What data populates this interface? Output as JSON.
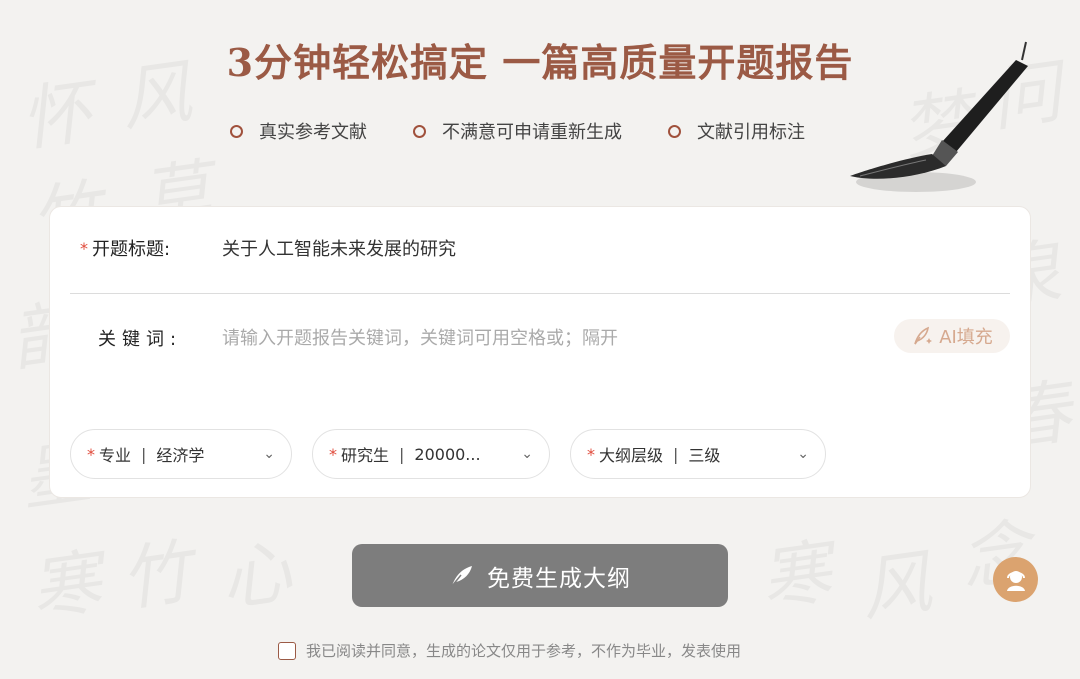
{
  "header": {
    "headline": "3分钟轻松搞定 一篇高质量开题报告",
    "features": [
      "真实参考文献",
      "不满意可申请重新生成",
      "文献引用标注"
    ]
  },
  "form": {
    "title_label": "开题标题:",
    "title_value": "关于人工智能未来发展的研究",
    "keywords_label": "关键词:",
    "keywords_placeholder": "请输入开题报告关键词，关键词可用空格或；隔开",
    "keywords_value": "",
    "ai_fill_label": "AI填充",
    "selects": [
      {
        "label": "专业",
        "value": "经济学"
      },
      {
        "label": "研究生",
        "value": "20000..."
      },
      {
        "label": "大纲层级",
        "value": "三级"
      }
    ]
  },
  "actions": {
    "generate_label": "免费生成大纲"
  },
  "agreement": {
    "text": "我已阅读并同意，生成的论文仅用于参考，不作为毕业，发表使用",
    "checked": false
  },
  "icons": {
    "feature_dot": "circle-bullet-icon",
    "brush": "calligraphy-brush-icon",
    "ai": "quill-sparkle-icon",
    "chevron": "chevron-down-icon",
    "generate": "quill-icon",
    "support": "customer-service-icon"
  },
  "colors": {
    "accent": "#9b5a45",
    "required": "#e04a3a",
    "button": "#7d7d7d",
    "support": "#dba36f"
  }
}
